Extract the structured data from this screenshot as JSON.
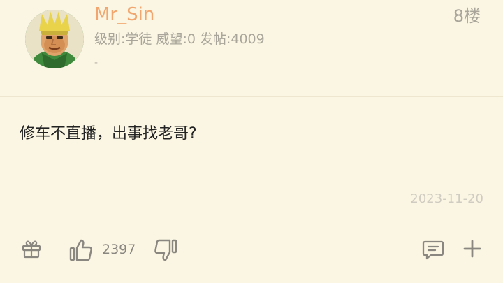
{
  "post": {
    "username": "Mr_Sin",
    "user_meta": "级别:学徒 威望:0 发帖:4009",
    "signature": "-",
    "floor": "8楼",
    "content": "修车不直播，出事找老哥?",
    "date": "2023-11-20",
    "like_count": "2397"
  },
  "icons": {
    "gift": "gift-icon",
    "like": "thumbs-up-icon",
    "dislike": "thumbs-down-icon",
    "comment": "comment-icon",
    "plus": "plus-icon"
  },
  "colors": {
    "background": "#fbf6e3",
    "username": "#f2a66e",
    "meta_text": "#a9a59a",
    "content_text": "#222222",
    "date_text": "#d0ccc1",
    "icon": "#8a8680"
  }
}
